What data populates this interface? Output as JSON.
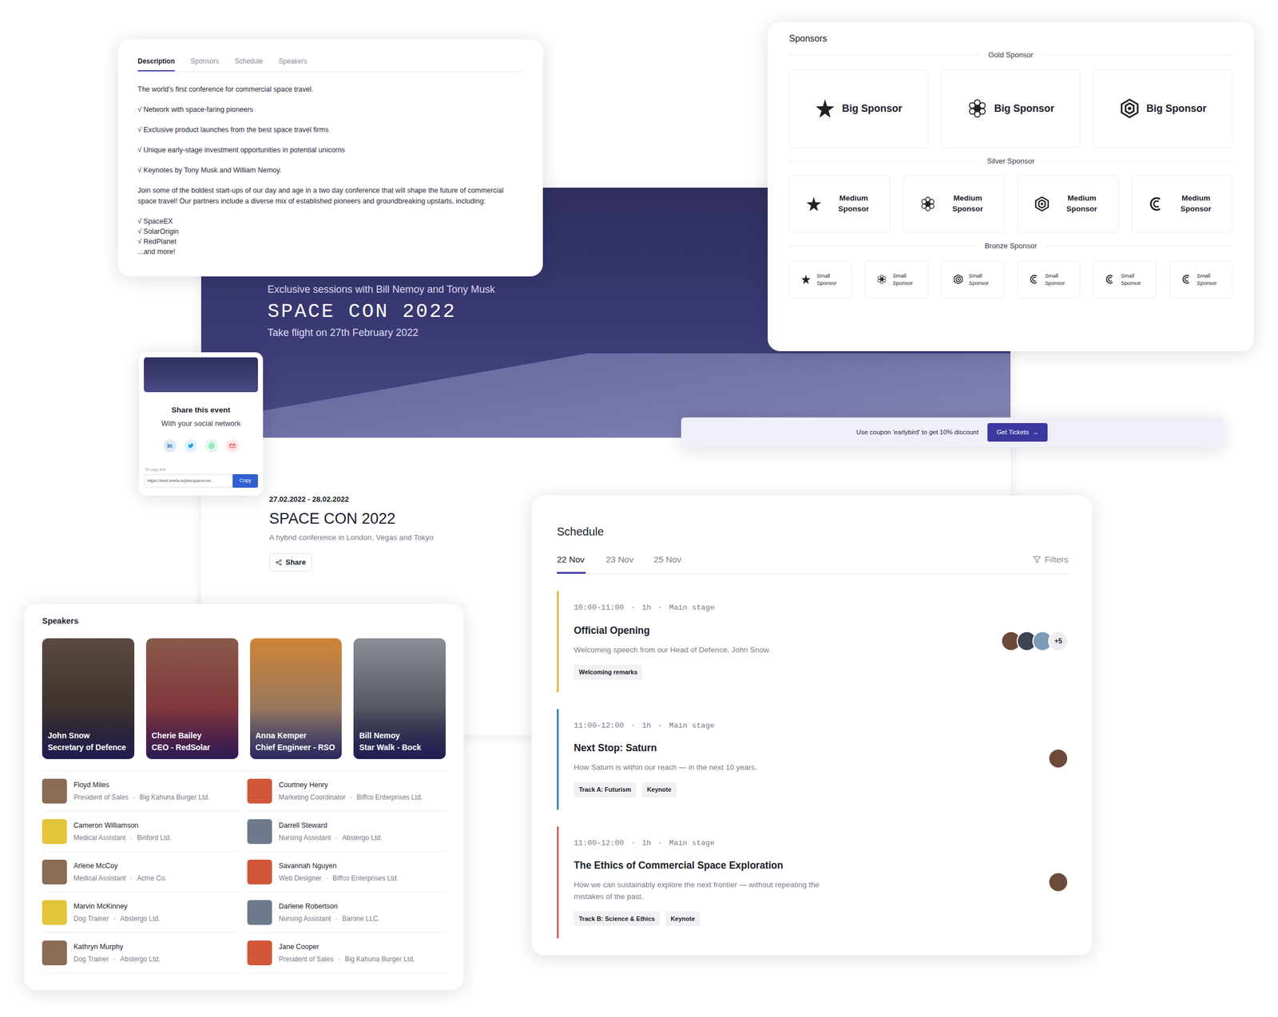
{
  "description": {
    "tabs": [
      {
        "label": "Description",
        "selected": true
      },
      {
        "label": "Sponsors",
        "selected": false
      },
      {
        "label": "Schedule",
        "selected": false
      },
      {
        "label": "Speakers",
        "selected": false
      }
    ],
    "blocks": [
      [
        "The world’s first conference for commercial space travel."
      ],
      [
        "√ Network with space-faring pioneers"
      ],
      [
        "√ Exclusive product launches from the best space travel firms"
      ],
      [
        "√ Unique early-stage investment opportunities in potential unicorns"
      ],
      [
        "√ Keynotes by Tony Musk and William Nemoy."
      ],
      [
        "Join some of the boldest start-ups of our day and age in a two day conference that will shape the future of commercial space travel! Our partners include a diverse mix of established pioneers and groundbreaking upstarts, including:"
      ],
      [
        "√ SpaceEX",
        "√ SolarOrigin",
        "√ RedPlanet",
        "...and more!"
      ]
    ]
  },
  "hero": {
    "kicker": "Exclusive sessions with Bill Nemoy and Tony Musk",
    "title": "SPACE CON 2022",
    "subtitle": "Take flight on 27th February 2022"
  },
  "event": {
    "dates": "27.02.2022 - 28.02.2022",
    "title": "SPACE CON 2022",
    "subtitle": "A hybrid conference in London, Vegas and Tokyo",
    "share_button": "Share"
  },
  "coupon": {
    "text": "Use coupon 'earlybird' to get 10% discount",
    "button": "Get Tickets",
    "button_icon": "→"
  },
  "share": {
    "title": "Share this event",
    "subtitle": "With your social network",
    "networks": [
      {
        "kind": "linkedin",
        "label": "in",
        "color": "#0a66c2"
      },
      {
        "kind": "twitter",
        "color": "#1d9bf0"
      },
      {
        "kind": "whatsapp",
        "color": "#25d366"
      },
      {
        "kind": "email",
        "color": "#e5484d"
      }
    ],
    "copy_caption": "Or copy link",
    "link": "https://next.brella.io/join/spacecon...",
    "copy_button": "Copy"
  },
  "sponsors": {
    "title": "Sponsors",
    "tiers": [
      {
        "name": "Gold Sponsor",
        "kind": "gold",
        "items": [
          {
            "label": "Big Sponsor",
            "logo": "star"
          },
          {
            "label": "Big Sponsor",
            "logo": "cluster"
          },
          {
            "label": "Big Sponsor",
            "logo": "hexagon"
          }
        ]
      },
      {
        "name": "Silver Sponsor",
        "kind": "silver",
        "items": [
          {
            "label": "Medium Sponsor",
            "logo": "star"
          },
          {
            "label": "Medium Sponsor",
            "logo": "cluster"
          },
          {
            "label": "Medium Sponsor",
            "logo": "hexagon"
          },
          {
            "label": "Medium Sponsor",
            "logo": "crescent"
          }
        ]
      },
      {
        "name": "Bronze Sponsor",
        "kind": "bronze",
        "items": [
          {
            "label": "Small Sponsor",
            "logo": "star"
          },
          {
            "label": "Small Sponsor",
            "logo": "cluster"
          },
          {
            "label": "Small Sponsor",
            "logo": "hexagon"
          },
          {
            "label": "Small Sponsor",
            "logo": "crescent"
          },
          {
            "label": "Small Sponsor",
            "logo": "crescent"
          },
          {
            "label": "Small Sponsor",
            "logo": "crescent"
          }
        ]
      }
    ]
  },
  "speakers": {
    "title": "Speakers",
    "separator": "·",
    "featured": [
      {
        "name": "John Snow",
        "role": "Secretary of Defence"
      },
      {
        "name": "Cherie Bailey",
        "role": "CEO - RedSolar"
      },
      {
        "name": "Anna Kemper",
        "role": "Chief Engineer - RSO"
      },
      {
        "name": "Bill Nemoy",
        "role": "Star Walk - Bock"
      }
    ],
    "list": [
      {
        "name": "Floyd Miles",
        "role": "President of Sales",
        "company": "Big Kahuna Burger Ltd."
      },
      {
        "name": "Courtney Henry",
        "role": "Marketing Coordinator",
        "company": "Biffco Enterprises Ltd."
      },
      {
        "name": "Cameron Williamson",
        "role": "Medical Assistant",
        "company": "Binford Ltd."
      },
      {
        "name": "Darrell Steward",
        "role": "Nursing Assistant",
        "company": "Abstergo Ltd."
      },
      {
        "name": "Arlene McCoy",
        "role": "Medical Assistant",
        "company": "Acme Co."
      },
      {
        "name": "Savannah Nguyen",
        "role": "Web Designer",
        "company": "Biffco Enterprises Ltd."
      },
      {
        "name": "Marvin McKinney",
        "role": "Dog Trainer",
        "company": "Abstergo Ltd."
      },
      {
        "name": "Darlene Robertson",
        "role": "Nursing Assistant",
        "company": "Barone LLC."
      },
      {
        "name": "Kathryn Murphy",
        "role": "Dog Trainer",
        "company": "Abstergo Ltd."
      },
      {
        "name": "Jane Cooper",
        "role": "President of Sales",
        "company": "Big Kahuna Burger Ltd."
      }
    ]
  },
  "schedule": {
    "title": "Schedule",
    "filters": "Filters",
    "separator": "·",
    "days": [
      {
        "label": "22 Nov",
        "selected": true
      },
      {
        "label": "23 Nov",
        "selected": false
      },
      {
        "label": "25 Nov",
        "selected": false
      }
    ],
    "sessions": [
      {
        "time": "10:00-11:00",
        "duration": "1h",
        "location": "Main stage",
        "title": "Official Opening",
        "description": "Welcoming speech from our Head of Defence, John Snow.",
        "tags": [
          "Welcoming remarks"
        ],
        "color": "#e8b03c",
        "avatars": 3,
        "more": "+5"
      },
      {
        "time": "11:00-12:00",
        "duration": "1h",
        "location": "Main stage",
        "title": "Next Stop: Saturn",
        "description": "How Saturn is within our reach — in the next 10 years.",
        "tags": [
          "Track A: Futurism",
          "Keynote"
        ],
        "color": "#2b7bb9",
        "avatars": 1
      },
      {
        "time": "11:00-12:00",
        "duration": "1h",
        "location": "Main stage",
        "title": "The Ethics of Commercial Space Exploration",
        "description": "How we can sustainably explore the next frontier — without repeating the mistakes of the past.",
        "tags": [
          "Track B: Science & Ethics",
          "Keynote"
        ],
        "color": "#d9534f",
        "avatars": 1
      }
    ]
  }
}
